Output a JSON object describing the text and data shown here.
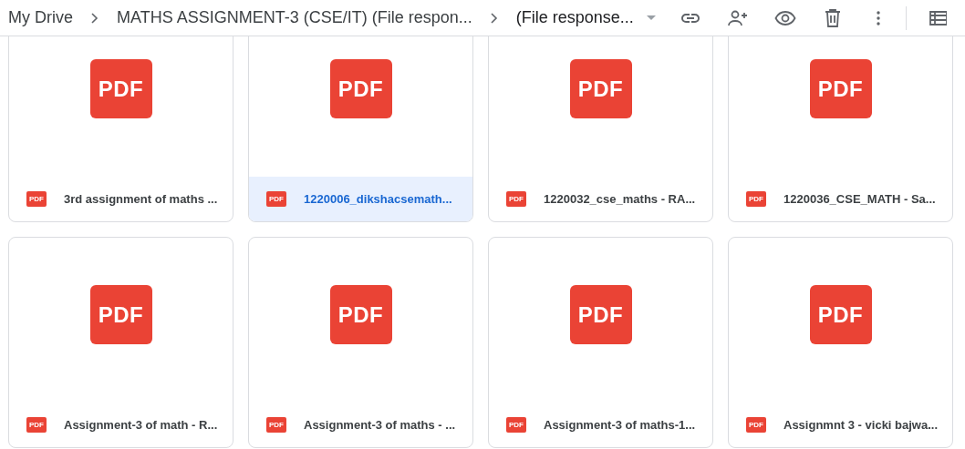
{
  "breadcrumb": [
    {
      "label": "My Drive",
      "dropdown": false
    },
    {
      "label": "MATHS ASSIGNMENT-3 (CSE/IT) (File respon...",
      "dropdown": false
    },
    {
      "label": "(File response...",
      "dropdown": true
    }
  ],
  "files": [
    {
      "name": "3rd assignment of maths ...",
      "thumbnail_label": "PDF",
      "icon_label": "PDF",
      "selected": false
    },
    {
      "name": "1220006_dikshacsemath...",
      "thumbnail_label": "PDF",
      "icon_label": "PDF",
      "selected": true
    },
    {
      "name": "1220032_cse_maths - RA...",
      "thumbnail_label": "PDF",
      "icon_label": "PDF",
      "selected": false
    },
    {
      "name": "1220036_CSE_MATH - Sa...",
      "thumbnail_label": "PDF",
      "icon_label": "PDF",
      "selected": false
    },
    {
      "name": "Assignment-3 of math - R...",
      "thumbnail_label": "PDF",
      "icon_label": "PDF",
      "selected": false
    },
    {
      "name": "Assignment-3 of maths - ...",
      "thumbnail_label": "PDF",
      "icon_label": "PDF",
      "selected": false
    },
    {
      "name": "Assignment-3 of maths-1...",
      "thumbnail_label": "PDF",
      "icon_label": "PDF",
      "selected": false
    },
    {
      "name": "Assignmnt 3 - vicki bajwa...",
      "thumbnail_label": "PDF",
      "icon_label": "PDF",
      "selected": false
    }
  ]
}
